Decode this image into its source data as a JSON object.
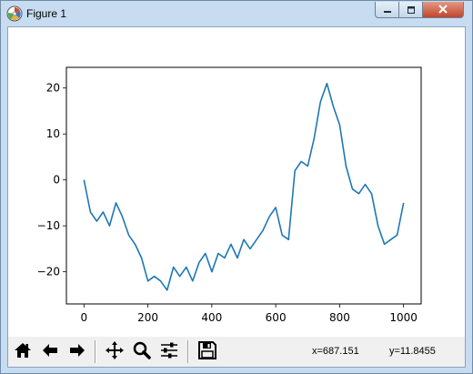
{
  "window": {
    "title": "Figure 1",
    "icon": "matplotlib-icon",
    "controls": [
      "minimize-icon",
      "maximize-icon",
      "close-icon"
    ]
  },
  "toolbar": {
    "buttons": [
      {
        "name": "home",
        "icon": "home-icon"
      },
      {
        "name": "back",
        "icon": "arrow-left-icon"
      },
      {
        "name": "forward",
        "icon": "arrow-right-icon"
      },
      {
        "name": "pan",
        "icon": "move-icon"
      },
      {
        "name": "zoom",
        "icon": "magnifier-icon"
      },
      {
        "name": "configure-subplots",
        "icon": "sliders-icon"
      },
      {
        "name": "save",
        "icon": "floppy-disk-icon"
      }
    ],
    "x_readout": "x=687.151",
    "y_readout": "y=11.8455"
  },
  "chart_data": {
    "type": "line",
    "title": "",
    "xlabel": "",
    "ylabel": "",
    "xlim": [
      -55,
      1055
    ],
    "ylim": [
      -27,
      24.5
    ],
    "xticks": [
      0,
      200,
      400,
      600,
      800,
      1000
    ],
    "yticks": [
      -20,
      -10,
      0,
      10,
      20
    ],
    "grid": false,
    "color": "#1f77b4",
    "series": [
      {
        "x": [
          0,
          20,
          40,
          60,
          80,
          100,
          120,
          140,
          160,
          180,
          200,
          220,
          240,
          260,
          280,
          300,
          320,
          340,
          360,
          380,
          400,
          420,
          440,
          460,
          480,
          500,
          520,
          540,
          560,
          580,
          600,
          620,
          640,
          660,
          680,
          700,
          720,
          740,
          760,
          780,
          800,
          820,
          840,
          860,
          880,
          900,
          920,
          940,
          960,
          980,
          1000
        ],
        "y": [
          0,
          -7,
          -9,
          -7,
          -10,
          -5,
          -8,
          -12,
          -14,
          -17,
          -22,
          -21,
          -22,
          -24,
          -19,
          -21,
          -19,
          -22,
          -18,
          -16,
          -20,
          -16,
          -17,
          -14,
          -17,
          -13,
          -15,
          -13,
          -11,
          -8,
          -6,
          -12,
          -13,
          2,
          4,
          3,
          9,
          17,
          21,
          16,
          12,
          3,
          -2,
          -3,
          -1,
          -3,
          -10,
          -14,
          -13,
          -12,
          -5
        ]
      }
    ]
  }
}
